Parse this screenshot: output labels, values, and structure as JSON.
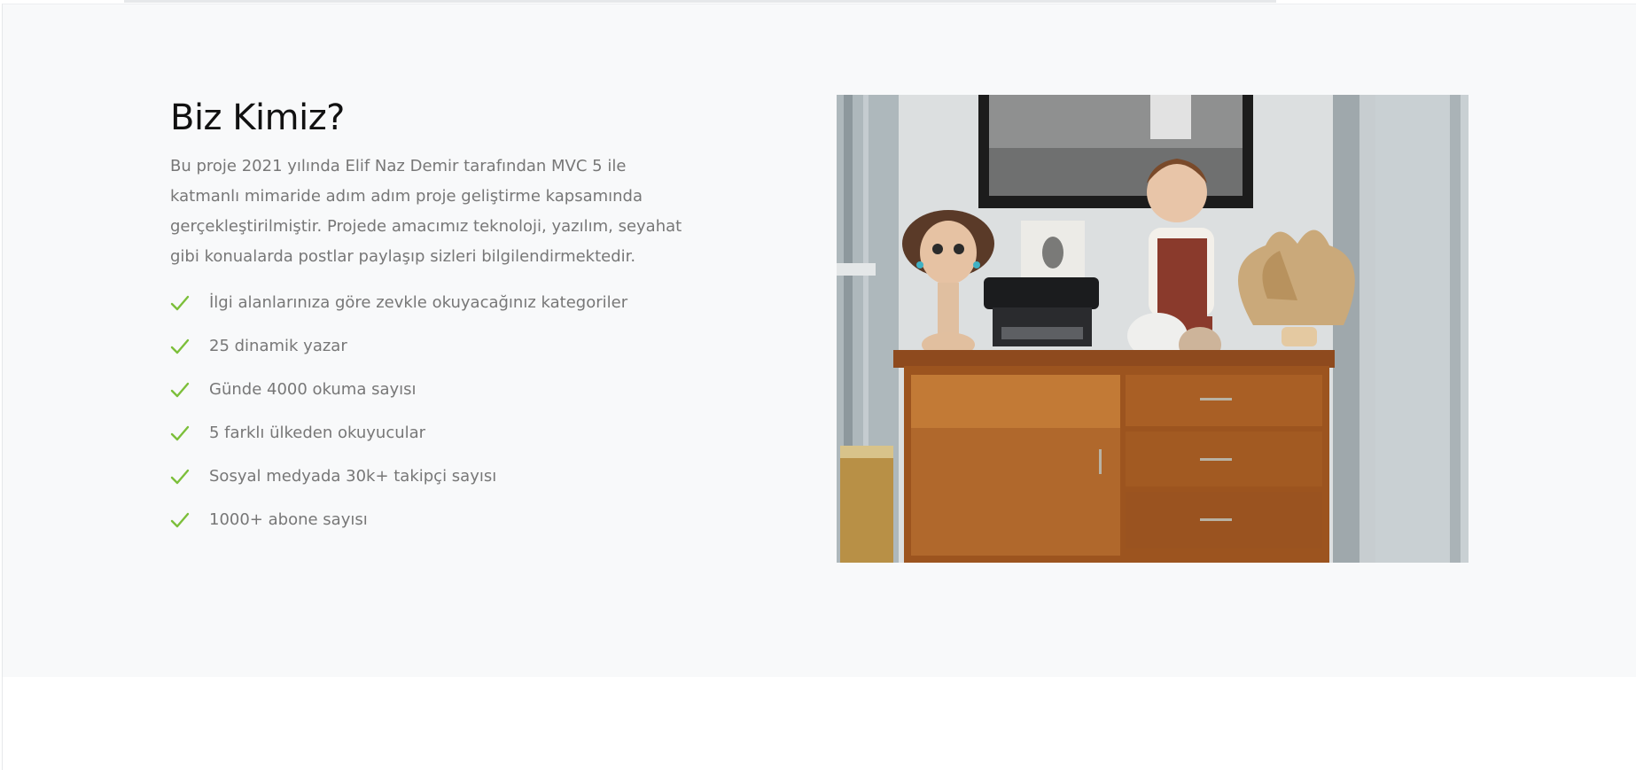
{
  "about": {
    "title": "Biz Kimiz?",
    "description": "Bu proje 2021 yılında Elif Naz Demir tarafından MVC 5 ile katmanlı mimaride adım adım proje geliştirme kapsamında gerçekleştirilmiştir. Projede amacımız teknoloji, yazılım, seyahat gibi konualarda postlar paylaşıp sizleri bilgilendirmektedir.",
    "features": [
      "İlgi alanlarınıza göre zevkle okuyacağınız kategoriler",
      "25 dinamik yazar",
      "Günde 4000 okuma sayısı",
      "5 farklı ülkeden okuyucular",
      "Sosyal medyada 30k+ takipçi sayısı",
      "1000+ abone sayısı"
    ]
  },
  "icons": {
    "feature_check": "check-icon"
  },
  "colors": {
    "check": "#7cbf3a",
    "section_background": "#f8f9fa",
    "title": "#111111",
    "body_text": "#777777"
  }
}
